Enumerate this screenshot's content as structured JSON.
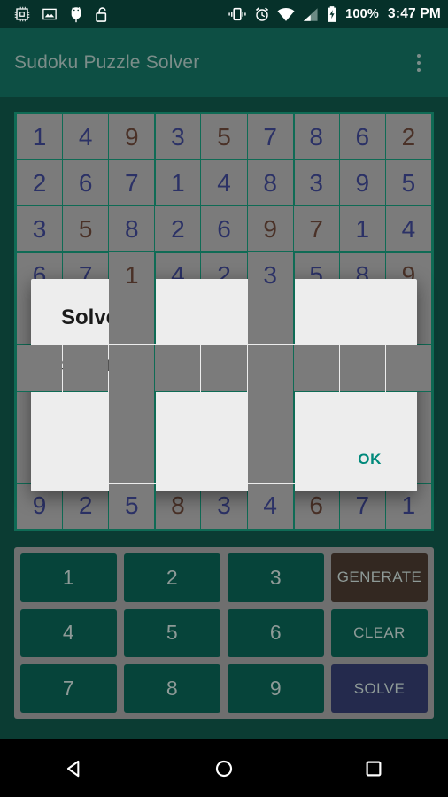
{
  "statusbar": {
    "icons_left": [
      "cpu-chip-icon",
      "image-icon",
      "android-debug-icon",
      "unlocked-padlock-icon"
    ],
    "icons_right": [
      "vibrate-icon",
      "alarm-icon",
      "wifi-icon",
      "cell-signal-icon",
      "battery-charging-icon"
    ],
    "battery_percent": "100%",
    "clock": "3:47 PM"
  },
  "appbar": {
    "title": "Sudoku Puzzle Solver",
    "overflow_label": "more-options"
  },
  "board": {
    "rows": [
      [
        "1",
        "4",
        "9",
        "3",
        "5",
        "7",
        "8",
        "6",
        "2"
      ],
      [
        "2",
        "6",
        "7",
        "1",
        "4",
        "8",
        "3",
        "9",
        "5"
      ],
      [
        "3",
        "5",
        "8",
        "2",
        "6",
        "9",
        "7",
        "1",
        "4"
      ],
      [
        "6",
        "7",
        "1",
        "4",
        "2",
        "3",
        "5",
        "8",
        "9"
      ],
      [
        "",
        "",
        "",
        "",
        "",
        "",
        "",
        "",
        ""
      ],
      [
        "",
        "",
        "",
        "",
        "",
        "",
        "",
        "",
        ""
      ],
      [
        "",
        "",
        "",
        "",
        "",
        "",
        "",
        "",
        ""
      ],
      [
        "",
        "",
        "",
        "",
        "",
        "",
        "",
        "",
        ""
      ],
      [
        "9",
        "2",
        "5",
        "8",
        "3",
        "4",
        "6",
        "7",
        "1"
      ]
    ],
    "given": [
      [
        false,
        false,
        true,
        false,
        true,
        false,
        false,
        false,
        true
      ],
      [
        false,
        false,
        false,
        false,
        false,
        false,
        false,
        false,
        false
      ],
      [
        false,
        true,
        false,
        false,
        false,
        true,
        true,
        false,
        false
      ],
      [
        false,
        false,
        true,
        false,
        false,
        false,
        false,
        false,
        true
      ],
      [
        false,
        false,
        false,
        false,
        false,
        false,
        false,
        false,
        false
      ],
      [
        false,
        false,
        false,
        false,
        false,
        false,
        false,
        false,
        false
      ],
      [
        false,
        false,
        false,
        false,
        false,
        false,
        false,
        false,
        false
      ],
      [
        false,
        false,
        false,
        false,
        false,
        false,
        false,
        false,
        false
      ],
      [
        false,
        false,
        false,
        true,
        false,
        false,
        true,
        false,
        false
      ]
    ],
    "solved_color": "#2b3166",
    "given_color": "#4a3127",
    "cell_color": "#7b7b7b",
    "grid_line_color": "#0f6b55"
  },
  "keypad": {
    "keys": [
      {
        "label": "1",
        "kind": "digit"
      },
      {
        "label": "2",
        "kind": "digit"
      },
      {
        "label": "3",
        "kind": "digit"
      },
      {
        "label": "GENERATE",
        "kind": "generate"
      },
      {
        "label": "4",
        "kind": "digit"
      },
      {
        "label": "5",
        "kind": "digit"
      },
      {
        "label": "6",
        "kind": "digit"
      },
      {
        "label": "CLEAR",
        "kind": "clear"
      },
      {
        "label": "7",
        "kind": "digit"
      },
      {
        "label": "8",
        "kind": "digit"
      },
      {
        "label": "9",
        "kind": "digit"
      },
      {
        "label": "SOLVE",
        "kind": "solve"
      }
    ],
    "digit_color": "#06443a",
    "generate_color": "#332821",
    "solve_color": "#242a4d"
  },
  "dialog": {
    "title": "Solver",
    "message": "Solved in ~2ms",
    "ok_label": "OK",
    "accent_color": "#00897b"
  },
  "navbar": {
    "back_label": "back",
    "home_label": "home",
    "recents_label": "recents"
  }
}
